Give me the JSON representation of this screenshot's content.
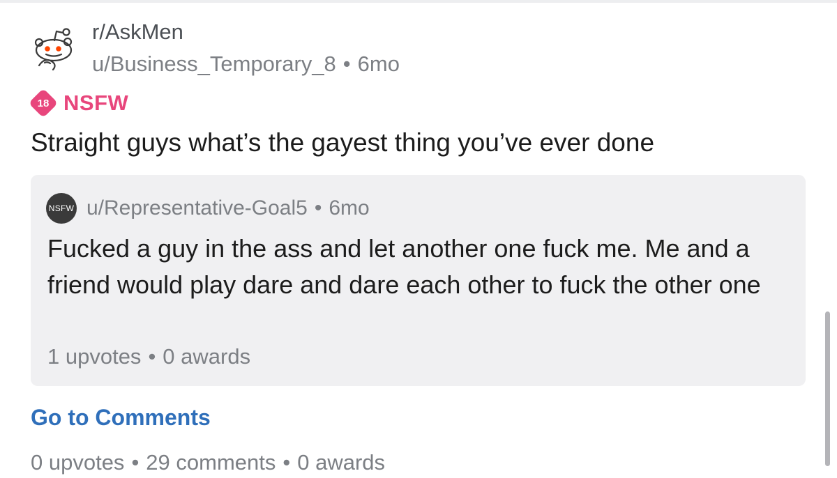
{
  "post": {
    "subreddit": "r/AskMen",
    "author": "u/Business_Temporary_8",
    "separator": "•",
    "age": "6mo",
    "nsfw_badge": "18",
    "nsfw_label": "NSFW",
    "title": "Straight guys what’s the gayest thing you’ve ever done",
    "go_to_comments": "Go to Comments",
    "upvotes": "0 upvotes",
    "comments": "29 comments",
    "awards": "0 awards"
  },
  "comment": {
    "avatar_text": "NSFW",
    "author": "u/Representative-Goal5",
    "separator": "•",
    "age": "6mo",
    "body": "Fucked a guy in the ass and let another one fuck me. Me and a friend would play dare and dare each other to fuck the other one",
    "upvotes": "1 upvotes",
    "awards": "0 awards"
  },
  "colors": {
    "nsfw": "#e8467c",
    "link": "#2f6fba",
    "muted_text": "#7c7f84",
    "card_bg": "#f0f0f2",
    "snoo_eyes": "#ff4500"
  },
  "icons": {
    "subreddit_avatar": "snoo-thinking-icon",
    "nsfw_badge": "nsfw-18-badge-icon"
  }
}
